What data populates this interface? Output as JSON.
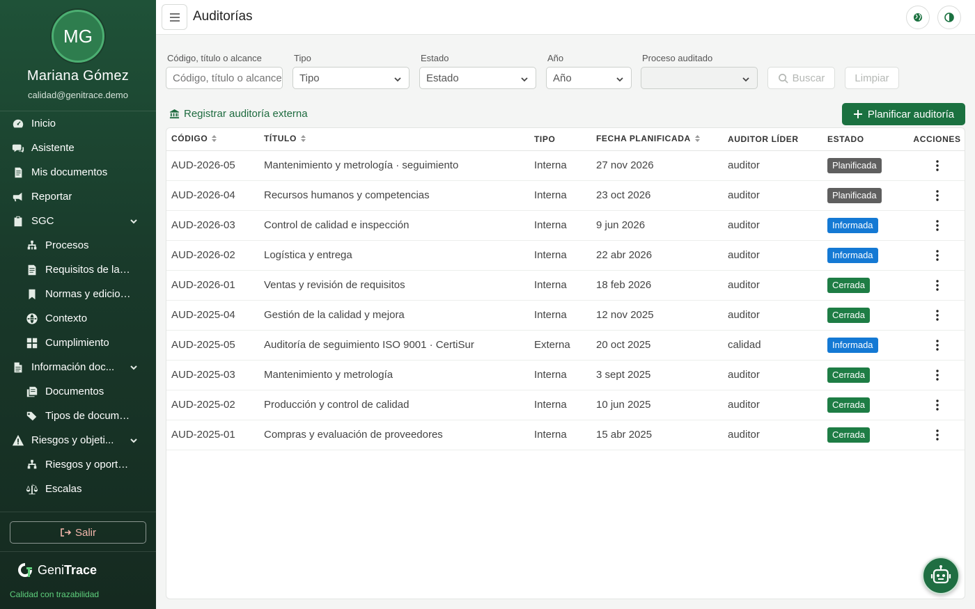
{
  "profile": {
    "initials": "MG",
    "name": "Mariana Gómez",
    "email": "calidad@genitrace.demo"
  },
  "nav": [
    {
      "label": "Inicio",
      "icon": "gauge-icon"
    },
    {
      "label": "Asistente",
      "icon": "chat-icon"
    },
    {
      "label": "Mis documentos",
      "icon": "document-icon"
    },
    {
      "label": "Reportar",
      "icon": "megaphone-icon"
    },
    {
      "label": "SGC",
      "icon": "clipboard-check-icon"
    },
    {
      "label": "Procesos",
      "icon": "sitemap-icon"
    },
    {
      "label": "Requisitos de la n...",
      "icon": "file-text-icon"
    },
    {
      "label": "Normas y edicion...",
      "icon": "bookmark-icon"
    },
    {
      "label": "Contexto",
      "icon": "globe-icon"
    },
    {
      "label": "Cumplimiento",
      "icon": "grid-icon"
    },
    {
      "label": "Información doc...",
      "icon": "file-icon"
    },
    {
      "label": "Documentos",
      "icon": "documents-icon"
    },
    {
      "label": "Tipos de docume...",
      "icon": "tags-icon"
    },
    {
      "label": "Riesgos y objeti...",
      "icon": "warning-icon"
    },
    {
      "label": "Riesgos y oportu...",
      "icon": "sitemap-icon"
    },
    {
      "label": "Escalas",
      "icon": "scale-icon"
    }
  ],
  "logout_label": "Salir",
  "brand": {
    "prefix": "Geni",
    "bold": "Trace",
    "tagline": "Calidad con trazabilidad"
  },
  "topbar": {
    "title": "Auditorías"
  },
  "filters": {
    "search": {
      "label": "Código, título o alcance",
      "placeholder": "Código, título o alcance"
    },
    "tipo": {
      "label": "Tipo",
      "value": "Tipo"
    },
    "estado": {
      "label": "Estado",
      "value": "Estado"
    },
    "anio": {
      "label": "Año",
      "value": "Año"
    },
    "proceso": {
      "label": "Proceso auditado",
      "value": ""
    },
    "buscar": "Buscar",
    "limpiar": "Limpiar"
  },
  "actions": {
    "external": "Registrar auditoría externa",
    "plan": "Planificar auditoría"
  },
  "table": {
    "headers": {
      "code": "CÓDIGO",
      "title": "TÍTULO",
      "tipo": "TIPO",
      "fecha": "FECHA PLANIFICADA",
      "auditor": "AUDITOR LÍDER",
      "estado": "ESTADO",
      "acciones": "ACCIONES"
    },
    "rows": [
      {
        "code": "AUD-2026-05",
        "title": "Mantenimiento y metrología · seguimiento",
        "tipo": "Interna",
        "fecha": "27 nov 2026",
        "auditor": "auditor",
        "estado": "Planificada"
      },
      {
        "code": "AUD-2026-04",
        "title": "Recursos humanos y competencias",
        "tipo": "Interna",
        "fecha": "23 oct 2026",
        "auditor": "auditor",
        "estado": "Planificada"
      },
      {
        "code": "AUD-2026-03",
        "title": "Control de calidad e inspección",
        "tipo": "Interna",
        "fecha": "9 jun 2026",
        "auditor": "auditor",
        "estado": "Informada"
      },
      {
        "code": "AUD-2026-02",
        "title": "Logística y entrega",
        "tipo": "Interna",
        "fecha": "22 abr 2026",
        "auditor": "auditor",
        "estado": "Informada"
      },
      {
        "code": "AUD-2026-01",
        "title": "Ventas y revisión de requisitos",
        "tipo": "Interna",
        "fecha": "18 feb 2026",
        "auditor": "auditor",
        "estado": "Cerrada"
      },
      {
        "code": "AUD-2025-04",
        "title": "Gestión de la calidad y mejora",
        "tipo": "Interna",
        "fecha": "12 nov 2025",
        "auditor": "auditor",
        "estado": "Cerrada"
      },
      {
        "code": "AUD-2025-05",
        "title": "Auditoría de seguimiento ISO 9001 · CertiSur",
        "tipo": "Externa",
        "fecha": "20 oct 2025",
        "auditor": "calidad",
        "estado": "Informada"
      },
      {
        "code": "AUD-2025-03",
        "title": "Mantenimiento y metrología",
        "tipo": "Interna",
        "fecha": "3 sept 2025",
        "auditor": "auditor",
        "estado": "Cerrada"
      },
      {
        "code": "AUD-2025-02",
        "title": "Producción y control de calidad",
        "tipo": "Interna",
        "fecha": "10 jun 2025",
        "auditor": "auditor",
        "estado": "Cerrada"
      },
      {
        "code": "AUD-2025-01",
        "title": "Compras y evaluación de proveedores",
        "tipo": "Interna",
        "fecha": "15 abr 2025",
        "auditor": "auditor",
        "estado": "Cerrada"
      }
    ]
  },
  "status_colors": {
    "Planificada": "#5f5f5f",
    "Informada": "#1479d4",
    "Cerrada": "#1e7d45"
  },
  "colors": {
    "accent": "#1b7140",
    "sidebar": "#1a3b2b"
  }
}
